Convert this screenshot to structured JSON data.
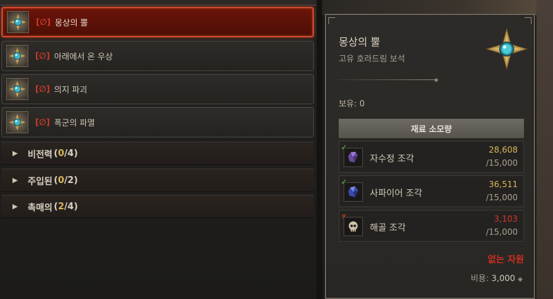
{
  "gems": [
    {
      "mark": "[∅]",
      "label": "몽상의 뿔",
      "selected": true
    },
    {
      "mark": "[∅]",
      "label": "아래에서 온 우상",
      "selected": false
    },
    {
      "mark": "[∅]",
      "label": "의지 파괴",
      "selected": false
    },
    {
      "mark": "[∅]",
      "label": "폭군의 파멸",
      "selected": false
    }
  ],
  "categories": [
    {
      "label": "비전력",
      "current": "0",
      "total": "4"
    },
    {
      "label": "주입된",
      "current": "0",
      "total": "2"
    },
    {
      "label": "촉매의",
      "current": "2",
      "total": "4"
    }
  ],
  "tooltip": {
    "title": "몽상의 뿔",
    "subtitle": "고유 호라드림 보석",
    "owned": "보유: 0",
    "materials_header": "재료 소모량",
    "materials": [
      {
        "name": "자수정 조각",
        "have": "28,608",
        "need": "/15,000",
        "ok": true,
        "icon": "amethyst-shard-icon"
      },
      {
        "name": "사파이어 조각",
        "have": "36,511",
        "need": "/15,000",
        "ok": true,
        "icon": "sapphire-shard-icon"
      },
      {
        "name": "해골 조각",
        "have": "3,103",
        "need": "/15,000",
        "ok": false,
        "icon": "skull-shard-icon"
      }
    ],
    "missing": "없는 자원",
    "cost_label": "비용:",
    "cost_value": "3,000"
  },
  "colors": {
    "selected_border": "#d04a2e",
    "ok_green": "#5ecf3a",
    "fail_red": "#d0392a",
    "gold": "#d8b65a"
  }
}
